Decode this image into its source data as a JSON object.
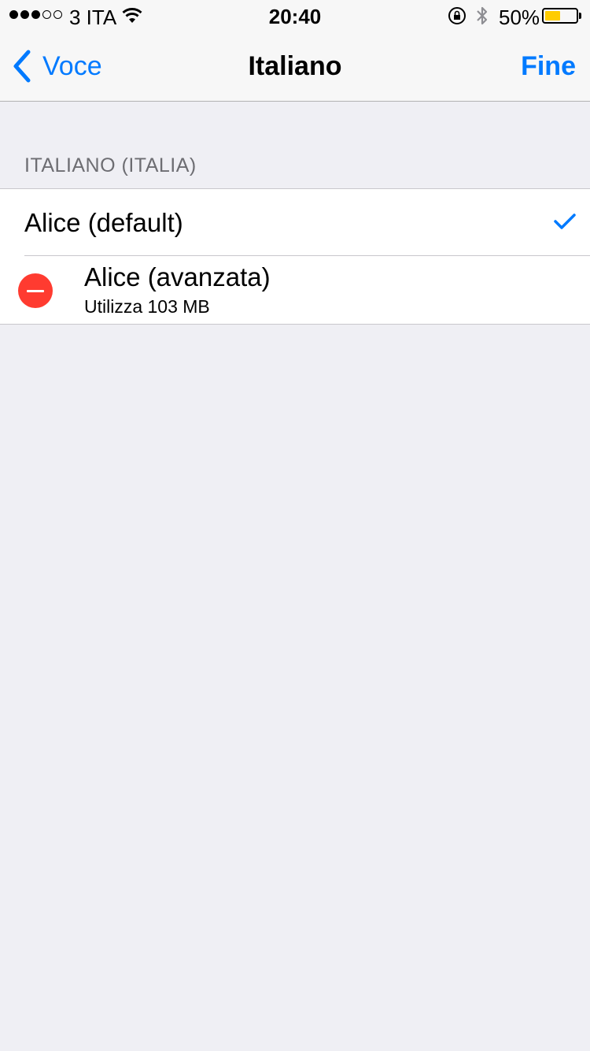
{
  "status_bar": {
    "carrier": "3 ITA",
    "time": "20:40",
    "battery_percent": "50%",
    "battery_level": 0.5,
    "signal_strength": 3,
    "signal_max": 5,
    "icons": [
      "wifi-icon",
      "rotation-lock-icon",
      "bluetooth-icon",
      "battery-icon"
    ],
    "battery_color": "#ffcc00"
  },
  "nav": {
    "back_label": "Voce",
    "title": "Italiano",
    "done_label": "Fine",
    "accent_color": "#007aff"
  },
  "section": {
    "header": "ITALIANO (ITALIA)",
    "rows": [
      {
        "title": "Alice (default)",
        "selected": true,
        "icon": "checkmark-icon"
      },
      {
        "title": "Alice (avanzata)",
        "subtitle": "Utilizza 103 MB",
        "icon": "delete-icon",
        "delete_color": "#ff3b30"
      }
    ]
  }
}
